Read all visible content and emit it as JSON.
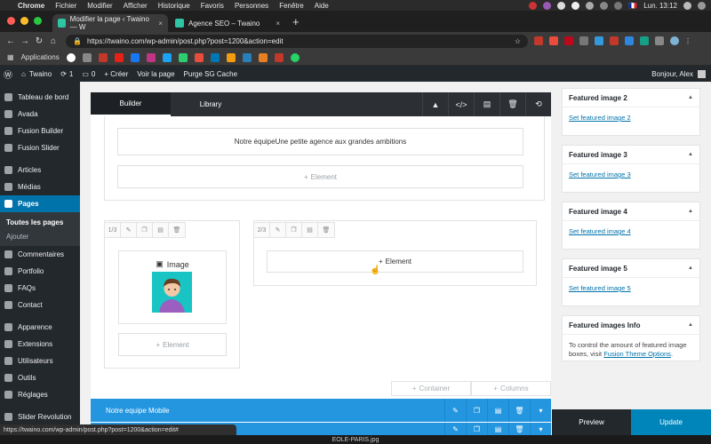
{
  "macbar": {
    "apple": "",
    "menus": [
      "Chrome",
      "Fichier",
      "Modifier",
      "Afficher",
      "Historique",
      "Favoris",
      "Personnes",
      "Fenêtre",
      "Aide"
    ],
    "flag": "🇫🇷",
    "clock": "Lun. 13:12"
  },
  "browser": {
    "tabs": [
      {
        "title": "Modifier la page ‹ Twaino — W",
        "active": true
      },
      {
        "title": "Agence SEO – Twaino",
        "active": false
      }
    ],
    "new_tab": "+",
    "url": "https://twaino.com/wp-admin/post.php?post=1200&action=edit",
    "bookmarks_label": "Applications"
  },
  "adminbar": {
    "site": "Twaino",
    "updates": "1",
    "comments": "0",
    "new": "+ Créer",
    "view": "Voir la page",
    "purge": "Purge SG Cache",
    "greeting": "Bonjour, Alex"
  },
  "sidebar": {
    "items": [
      {
        "label": "Tableau de bord"
      },
      {
        "label": "Avada"
      },
      {
        "label": "Fusion Builder"
      },
      {
        "label": "Fusion Slider"
      },
      {
        "label": "Articles"
      },
      {
        "label": "Médias"
      },
      {
        "label": "Pages"
      },
      {
        "label": "Commentaires"
      },
      {
        "label": "Portfolio"
      },
      {
        "label": "FAQs"
      },
      {
        "label": "Contact"
      },
      {
        "label": "Apparence"
      },
      {
        "label": "Extensions"
      },
      {
        "label": "Utilisateurs"
      },
      {
        "label": "Outils"
      },
      {
        "label": "Réglages"
      },
      {
        "label": "Slider Revolution"
      }
    ],
    "submenu": [
      "Toutes les pages",
      "Ajouter"
    ]
  },
  "builder": {
    "tabs": [
      "Builder",
      "Library"
    ],
    "icons": [
      "caret-up",
      "code",
      "save",
      "trash",
      "history"
    ],
    "text_block": "Notre équipeUne petite agence aux grandes ambitions",
    "element_label": "Element",
    "col1_size": "1/3",
    "col2_size": "2/3",
    "image_label": "Image",
    "container_label": "Container",
    "columns_label": "Columns",
    "section_label": "Notre equipe Mobile"
  },
  "panels": [
    {
      "title": "Featured image 2",
      "link": "Set featured image 2"
    },
    {
      "title": "Featured image 3",
      "link": "Set featured image 3"
    },
    {
      "title": "Featured image 4",
      "link": "Set featured image 4"
    },
    {
      "title": "Featured image 5",
      "link": "Set featured image 5"
    }
  ],
  "info_panel": {
    "title": "Featured images Info",
    "text": "To control the amount of featured image boxes, visit",
    "link": "Fusion Theme Options",
    "suffix": "."
  },
  "actions": {
    "preview": "Preview",
    "update": "Update"
  },
  "status_url": "https://twaino.com/wp-admin/post.php?post=1200&action=edit#",
  "dock_label": "EOLE-PARIS.jpg",
  "colors": {
    "wp_dark": "#23282d",
    "wp_blue": "#0073aa",
    "section_blue": "#2496e0",
    "update_blue": "#0085ba"
  }
}
